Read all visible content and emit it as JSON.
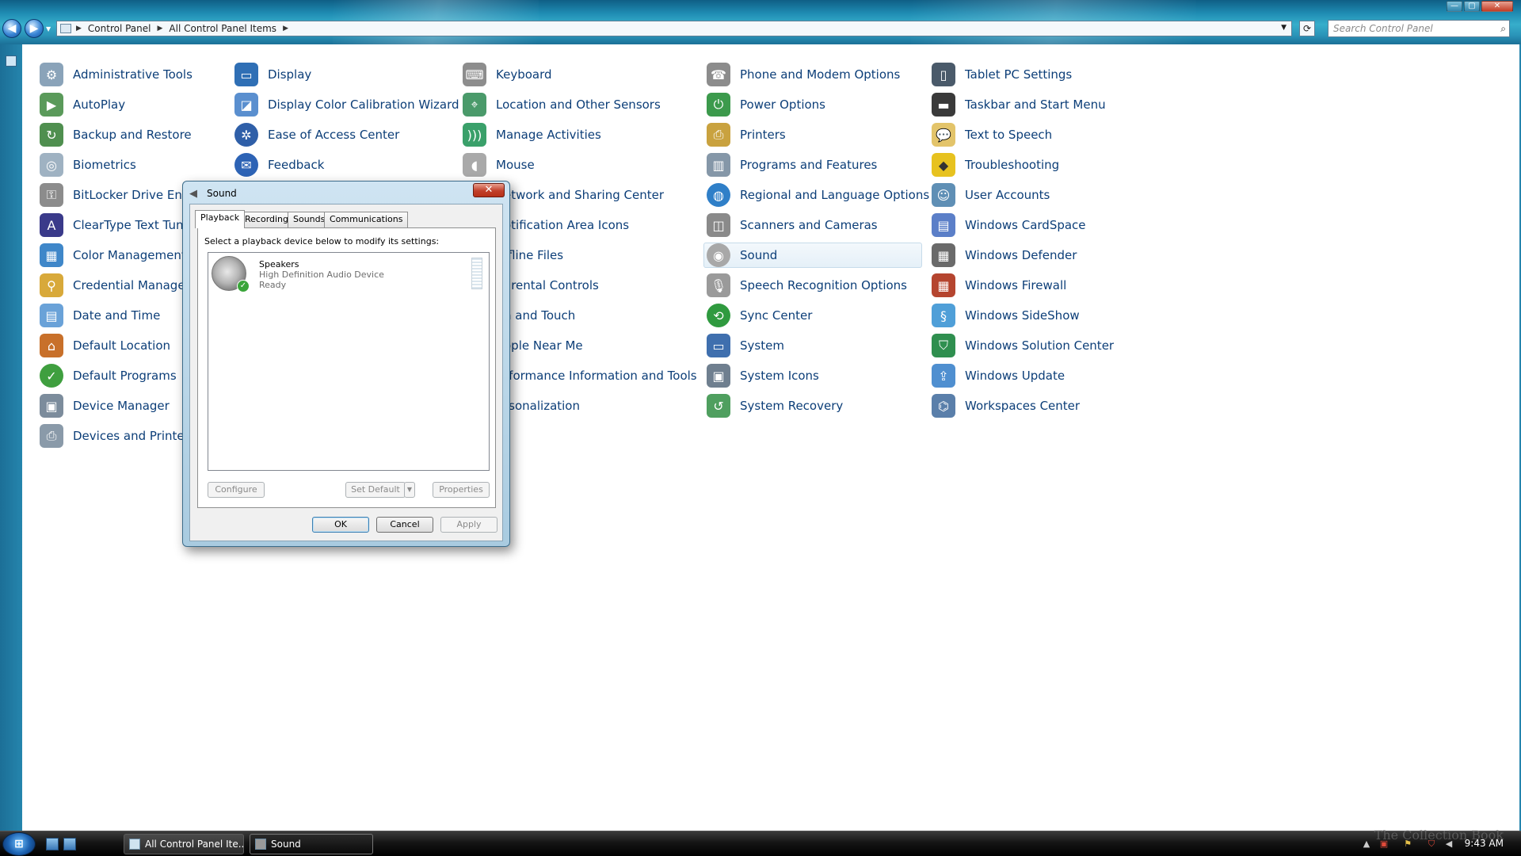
{
  "window": {
    "buttons": {
      "minimize": "—",
      "maximize": "▢",
      "close": "✕"
    }
  },
  "nav": {
    "back": "◀",
    "forward": "▶",
    "breadcrumbs": [
      "Control Panel",
      "All Control Panel Items"
    ],
    "search_placeholder": "Search Control Panel"
  },
  "control_panel": {
    "col1": [
      "Administrative Tools",
      "AutoPlay",
      "Backup and Restore",
      "Biometrics",
      "BitLocker Drive Enc",
      "ClearType Text Tuni",
      "Color Management",
      "Credential Manager",
      "Date and Time",
      "Default Location",
      "Default Programs",
      "Device Manager",
      "Devices and Printers"
    ],
    "col2": [
      "Display",
      "Display Color Calibration Wizard",
      "Ease of Access Center",
      "Feedback"
    ],
    "col3": [
      "Keyboard",
      "Location and Other Sensors",
      "Manage Activities",
      "Mouse",
      "etwork and Sharing Center",
      "otification Area Icons",
      "ffline Files",
      "arental Controls",
      "n and Touch",
      "ople Near Me",
      "rformance Information and Tools",
      "rsonalization"
    ],
    "col4": [
      "Phone and Modem Options",
      "Power Options",
      "Printers",
      "Programs and Features",
      "Regional and Language Options",
      "Scanners and Cameras",
      "Sound",
      "Speech Recognition Options",
      "Sync Center",
      "System",
      "System Icons",
      "System Recovery"
    ],
    "col5": [
      "Tablet PC Settings",
      "Taskbar and Start Menu",
      "Text to Speech",
      "Troubleshooting",
      "User Accounts",
      "Windows CardSpace",
      "Windows Defender",
      "Windows Firewall",
      "Windows SideShow",
      "Windows Solution Center",
      "Windows Update",
      "Workspaces Center"
    ]
  },
  "dialog": {
    "title": "Sound",
    "close": "✕",
    "tabs": [
      "Playback",
      "Recording",
      "Sounds",
      "Communications"
    ],
    "instruction": "Select a playback device below to modify its settings:",
    "device": {
      "name": "Speakers",
      "desc": "High Definition Audio Device",
      "status": "Ready"
    },
    "buttons": {
      "configure": "Configure",
      "set_default": "Set Default",
      "properties": "Properties",
      "ok": "OK",
      "cancel": "Cancel",
      "apply": "Apply"
    }
  },
  "taskbar": {
    "start": "⊞",
    "tasks": [
      "All Control Panel Ite...",
      "Sound"
    ],
    "clock": "9:43 AM"
  },
  "watermark": "The Collection Book"
}
